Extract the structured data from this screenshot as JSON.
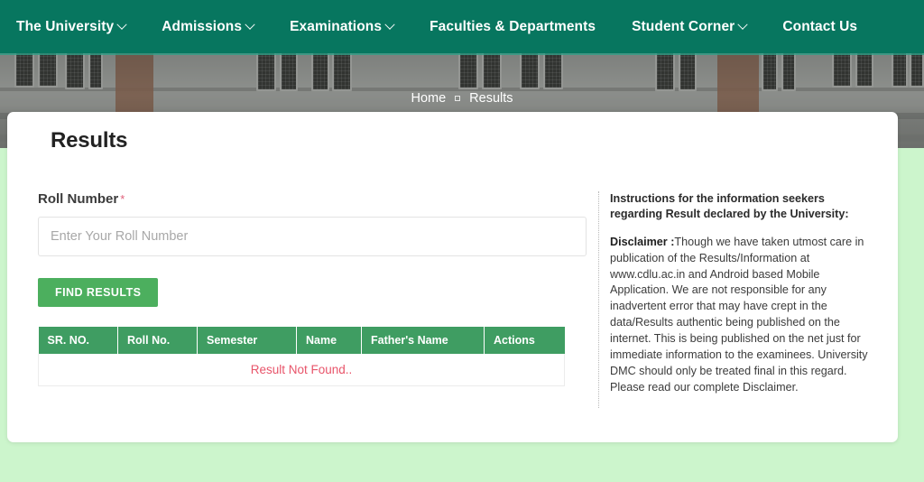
{
  "nav": {
    "items": [
      {
        "label": "The University",
        "has_dropdown": true,
        "icon": "chevron-down-icon"
      },
      {
        "label": "Admissions",
        "has_dropdown": true,
        "icon": "chevron-down-icon"
      },
      {
        "label": "Examinations",
        "has_dropdown": true,
        "icon": "chevron-down-icon"
      },
      {
        "label": "Faculties & Departments",
        "has_dropdown": false,
        "icon": ""
      },
      {
        "label": "Student Corner",
        "has_dropdown": true,
        "icon": "chevron-down-icon"
      },
      {
        "label": "Contact Us",
        "has_dropdown": false,
        "icon": ""
      }
    ],
    "background_color": "#07765f"
  },
  "breadcrumb": {
    "home_label": "Home",
    "separator_icon": "square-separator-icon",
    "current_label": "Results"
  },
  "card": {
    "title": "Results"
  },
  "form": {
    "roll_label": "Roll Number",
    "required_marker": "*",
    "roll_placeholder": "Enter Your Roll Number",
    "roll_value": "",
    "submit_label": "FIND RESULTS",
    "submit_color": "#4caf5e"
  },
  "results_table": {
    "header_color": "#3f9d62",
    "columns": [
      "SR. NO.",
      "Roll No.",
      "Semester",
      "Name",
      "Father's Name",
      "Actions"
    ],
    "rows": [],
    "empty_message": "Result Not Found..",
    "empty_message_color": "#e8546a"
  },
  "instructions": {
    "heading": "Instructions for the information seekers regarding Result declared by the University:",
    "disclaimer_label": "Disclaimer :",
    "disclaimer_text": "Though we have taken utmost care in publication of the Results/Information at www.cdlu.ac.in and Android based Mobile Application. We are not responsible for any inadvertent error that may have crept in the data/Results authentic being published on the internet. This is being published on the net just for immediate information to the examinees. University DMC should only be treated final in this regard. Please read our complete Disclaimer."
  },
  "page": {
    "background_color": "#ccf5cc"
  }
}
